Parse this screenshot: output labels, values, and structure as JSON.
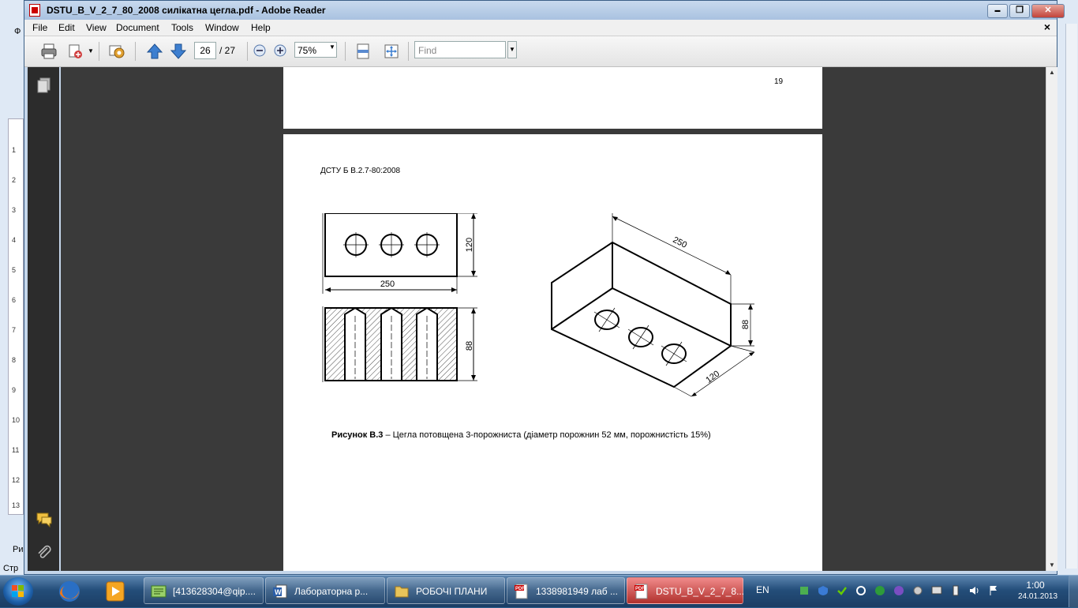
{
  "window": {
    "title": "DSTU_B_V_2_7_80_2008 силікатна цегла.pdf - Adobe Reader",
    "controls": {
      "minimize": "▬",
      "restore": "❐",
      "close": "✕"
    }
  },
  "menu": {
    "items": [
      "File",
      "Edit",
      "View",
      "Document",
      "Tools",
      "Window",
      "Help"
    ],
    "close_doc": "×"
  },
  "toolbar": {
    "current_page": "26",
    "total_pages": "/ 27",
    "zoom": "75%",
    "find_placeholder": "Find",
    "icons": [
      "print-icon",
      "share-icon",
      "collaborate-icon",
      "page-up-icon",
      "page-down-icon",
      "zoom-out-icon",
      "zoom-in-icon",
      "fit-width-icon",
      "full-screen-icon"
    ]
  },
  "nav_pane": {
    "icons": [
      "pages-icon",
      "comments-icon",
      "attachments-icon"
    ]
  },
  "document": {
    "page_number_top": "19",
    "doc_code": "ДСТУ Б В.2.7-80:2008",
    "figure": {
      "dimensions": {
        "front_width": "250",
        "front_height": "120",
        "section_height": "88",
        "iso_length": "250",
        "iso_height": "88",
        "iso_width": "120"
      },
      "caption_bold": "Рисунок В.3",
      "caption_text": " – Цегла потовщена 3-порожниста (діаметр порожнин 52 мм, порожнистість 15%)"
    }
  },
  "background_app": {
    "ruler_marks": [
      "1",
      "2",
      "3",
      "4",
      "5",
      "6",
      "7",
      "8",
      "9",
      "10",
      "11",
      "12",
      "13"
    ],
    "left_edge_text": [
      "Ф",
      "Ри",
      "Стр"
    ]
  },
  "taskbar": {
    "tasks": [
      {
        "label": "[413628304@qip....",
        "icon": "qip-icon"
      },
      {
        "label": "Лабораторна р...",
        "icon": "word-icon"
      },
      {
        "label": "РОБОЧІ ПЛАНИ",
        "icon": "folder-icon"
      },
      {
        "label": "1338981949 лаб ...",
        "icon": "pdf-icon"
      },
      {
        "label": "DSTU_B_V_2_7_8...",
        "icon": "pdf-icon",
        "active": true
      }
    ],
    "language": "EN",
    "time": "1:00",
    "date": "24.01.2013"
  },
  "colors": {
    "title_bar": "#b9cde6",
    "doc_background": "#3a3a3a",
    "taskbar": "#244e7a",
    "active_task": "#c0403a"
  }
}
